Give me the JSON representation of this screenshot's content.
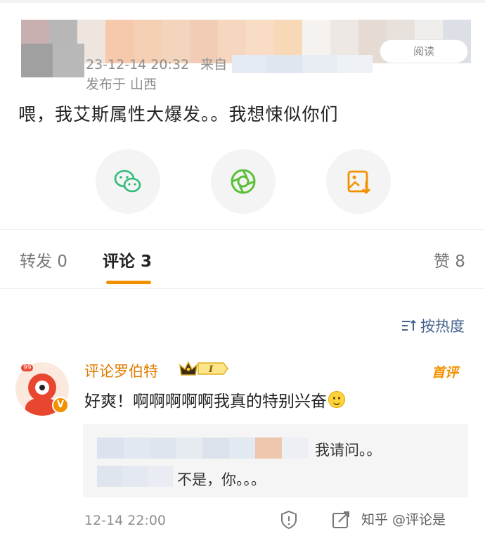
{
  "post": {
    "timestamp": "23-12-14 20:32",
    "source_prefix": "来自",
    "location": "发布于 山西",
    "read_label": "阅读",
    "text": "喂，我艾斯属性大爆发。。我想悚似你们"
  },
  "share": {
    "icons": [
      "wechat-icon",
      "moments-icon",
      "save-image-icon"
    ]
  },
  "tabs": {
    "repost": "转发 0",
    "comment": "评论 3",
    "like": "赞 8"
  },
  "sort_label": "按热度",
  "comment": {
    "author": "评论罗伯特",
    "level_badge": "99",
    "rank_badge": "I",
    "first_tag": "首评",
    "text": "好爽！啊啊啊啊啊我真的特别兴奋",
    "replies": [
      "我请问。。",
      "不是，你。。。"
    ],
    "time": "12-14 22:00"
  },
  "watermark": "知乎 @评论是",
  "colors": {
    "accent": "#f29100",
    "link": "#44628f",
    "name": "#e07c00",
    "wechat": "#2fbb7a",
    "moments": "#5bbf3a"
  }
}
